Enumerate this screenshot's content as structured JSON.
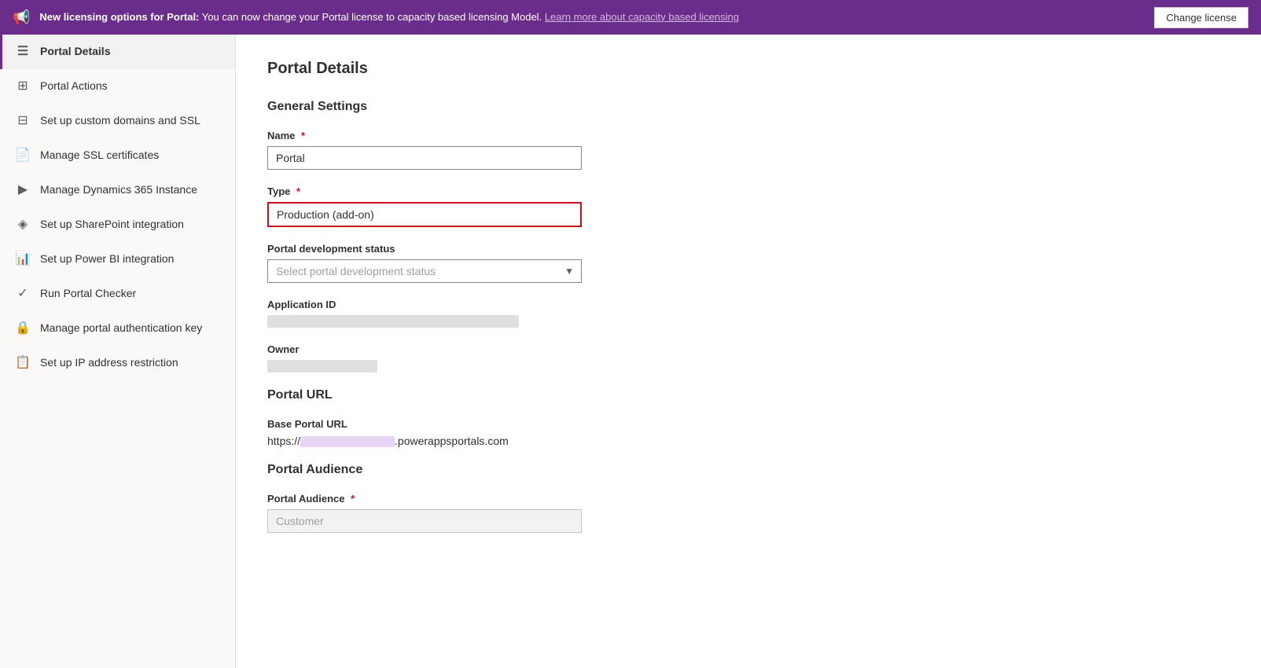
{
  "banner": {
    "icon": "📢",
    "text_bold": "New licensing options for Portal:",
    "text_normal": " You can now change your Portal license to capacity based licensing Model.",
    "link_text": "Learn more about capacity based licensing",
    "button_label": "Change license"
  },
  "sidebar": {
    "items": [
      {
        "id": "portal-details",
        "label": "Portal Details",
        "icon": "☰",
        "active": true
      },
      {
        "id": "portal-actions",
        "label": "Portal Actions",
        "icon": "⊞",
        "active": false
      },
      {
        "id": "custom-domains",
        "label": "Set up custom domains and SSL",
        "icon": "⊟",
        "active": false
      },
      {
        "id": "ssl-certs",
        "label": "Manage SSL certificates",
        "icon": "📄",
        "active": false
      },
      {
        "id": "dynamics-instance",
        "label": "Manage Dynamics 365 Instance",
        "icon": "▶",
        "active": false
      },
      {
        "id": "sharepoint",
        "label": "Set up SharePoint integration",
        "icon": "S",
        "active": false
      },
      {
        "id": "power-bi",
        "label": "Set up Power BI integration",
        "icon": "📊",
        "active": false
      },
      {
        "id": "portal-checker",
        "label": "Run Portal Checker",
        "icon": "☑",
        "active": false
      },
      {
        "id": "auth-key",
        "label": "Manage portal authentication key",
        "icon": "🔒",
        "active": false
      },
      {
        "id": "ip-restriction",
        "label": "Set up IP address restriction",
        "icon": "📋",
        "active": false
      }
    ]
  },
  "content": {
    "page_title": "Portal Details",
    "general_settings": {
      "section_title": "General Settings",
      "name_label": "Name",
      "name_value": "Portal",
      "name_required": true,
      "type_label": "Type",
      "type_value": "Production (add-on)",
      "type_required": true,
      "type_highlighted": true,
      "portal_dev_status_label": "Portal development status",
      "portal_dev_status_placeholder": "Select portal development status",
      "application_id_label": "Application ID",
      "owner_label": "Owner"
    },
    "portal_url": {
      "section_title": "Portal URL",
      "base_url_label": "Base Portal URL",
      "base_url_prefix": "https://",
      "base_url_suffix": ".powerappsportals.com"
    },
    "portal_audience": {
      "section_title": "Portal Audience",
      "audience_label": "Portal Audience",
      "audience_required": true,
      "audience_value": "Customer"
    }
  }
}
